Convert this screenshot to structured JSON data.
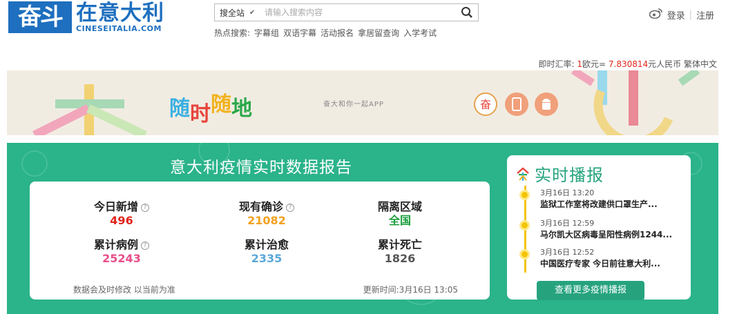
{
  "header": {
    "logo_main": "奋斗",
    "logo_cn": "在意大利",
    "logo_en": "CINESEITALIA.COM",
    "search": {
      "scope": "搜全站",
      "placeholder": "请输入搜索内容"
    },
    "hot": {
      "label": "热点搜索:",
      "items": [
        "字幕组",
        "双语字幕",
        "活动报名",
        "拿居留查询",
        "入学考试"
      ]
    },
    "login": "登录",
    "register": "注册"
  },
  "rate": {
    "label": "即时汇率:",
    "from": "1",
    "from_unit": "欧元=",
    "to": "7.830814",
    "to_unit": "元人民币",
    "traditional": "繁体中文"
  },
  "banner": {
    "slogan": "随时随地",
    "subtitle": "奋大和你一起APP"
  },
  "report": {
    "title": "意大利疫情实时数据报告",
    "stats": [
      {
        "label": "今日新增",
        "value": "496",
        "color": "#e0241b",
        "help": true
      },
      {
        "label": "现有确诊",
        "value": "21082",
        "color": "#f2a01e",
        "help": true
      },
      {
        "label": "隔离区域",
        "value": "全国",
        "color": "#1b9e3d",
        "help": false
      },
      {
        "label": "累计病例",
        "value": "25243",
        "color": "#e84d8a",
        "help": true
      },
      {
        "label": "累计治愈",
        "value": "2335",
        "color": "#59a8d9",
        "help": false
      },
      {
        "label": "累计死亡",
        "value": "1826",
        "color": "#555555",
        "help": false
      }
    ],
    "note": "数据会及时修改 以当前为准",
    "updated": "更新时间:3月16日 13:05"
  },
  "live": {
    "title": "实时播报",
    "items": [
      {
        "time": "3月16日 13:20",
        "text": "监狱工作室将改建供口罩生产..."
      },
      {
        "time": "3月16日 12:59",
        "text": "马尔凯大区病毒呈阳性病例1244..."
      },
      {
        "time": "3月16日 12:52",
        "text": "中国医疗专家 今日前往意大利..."
      }
    ],
    "more": "查看更多疫情播报"
  }
}
